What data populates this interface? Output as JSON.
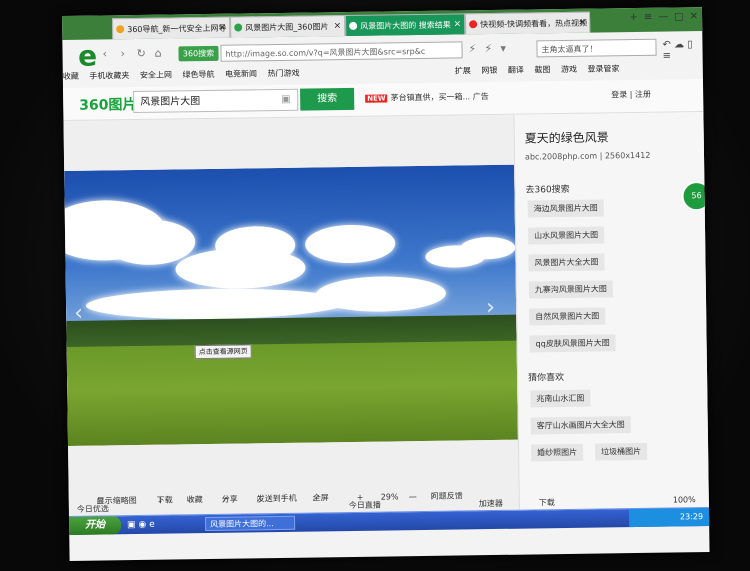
{
  "tabs": [
    {
      "label": "360导航_新一代安全上网导"
    },
    {
      "label": "风景图片大图_360图片"
    },
    {
      "label": "风景图片大图的 搜索结果"
    },
    {
      "label": "快视频-快调频看看，热点视频"
    }
  ],
  "window_controls": {
    "minimize": "—",
    "maximize": "□",
    "close": "✕",
    "menu": "≡"
  },
  "address": {
    "engine": "360搜索",
    "url": "http://image.so.com/v?q=风景图片大图&src=srp&c",
    "search_placeholder": "主角太逼真了！"
  },
  "bookmarks": {
    "items": [
      "收藏",
      "手机收藏夹",
      "安全上网",
      "绿色导航",
      "电竞新闻",
      "热门游戏"
    ],
    "right": [
      "扩展",
      "网银",
      "翻译",
      "截图",
      "游戏",
      "登录管家"
    ]
  },
  "header": {
    "brand": "360图片",
    "query": "风景图片大图",
    "search_btn": "搜索",
    "ad_badge": "NEW",
    "ad_text": "茅台镇直供，买一箱...",
    "ad_label": "广告",
    "login": "登录 | 注册"
  },
  "viewer": {
    "tooltip": "点击查看源网页",
    "toolbar": [
      "显示缩略图",
      "下载",
      "收藏",
      "分享",
      "发送到手机",
      "全屏",
      "+",
      "29%",
      "—",
      "问题反馈"
    ]
  },
  "panel": {
    "title": "夏天的绿色风景",
    "meta": "abc.2008php.com | 2560x1412",
    "search_section": "去360搜索",
    "search_tags": [
      "海边风景图片大图",
      "山水风景图片大图",
      "风景图片大全大图",
      "九寨沟风景图片大图",
      "自然风景图片大图",
      "qq皮肤风景图片大图"
    ],
    "guess_section": "猜你喜欢",
    "guess_tags": [
      "兆南山水汇图",
      "客厅山水画图片大全大图",
      "婚纱照图片",
      "垃圾桶图片"
    ]
  },
  "side_badge": "56",
  "statusbar": {
    "fav": "今日优选",
    "live": "今日直播",
    "fast": "加速器",
    "download": "下载",
    "zoom": "100%"
  },
  "taskbar": {
    "start": "开始",
    "task": "风景图片大图的...",
    "time": "23:29"
  }
}
